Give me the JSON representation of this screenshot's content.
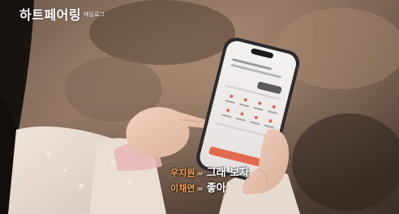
{
  "logo": {
    "title": "하트페어링",
    "subtitle": "메일로그"
  },
  "subtitles": [
    {
      "speaker": "우지원",
      "icon": "infinity-icon",
      "text": "그래 보자"
    },
    {
      "speaker": "이채연",
      "icon": "infinity-icon",
      "text": "좋아"
    }
  ],
  "colors": {
    "speaker": "#f0a25a",
    "subtitle_text": "#ffffff",
    "screen_accent": "#e2694d"
  }
}
